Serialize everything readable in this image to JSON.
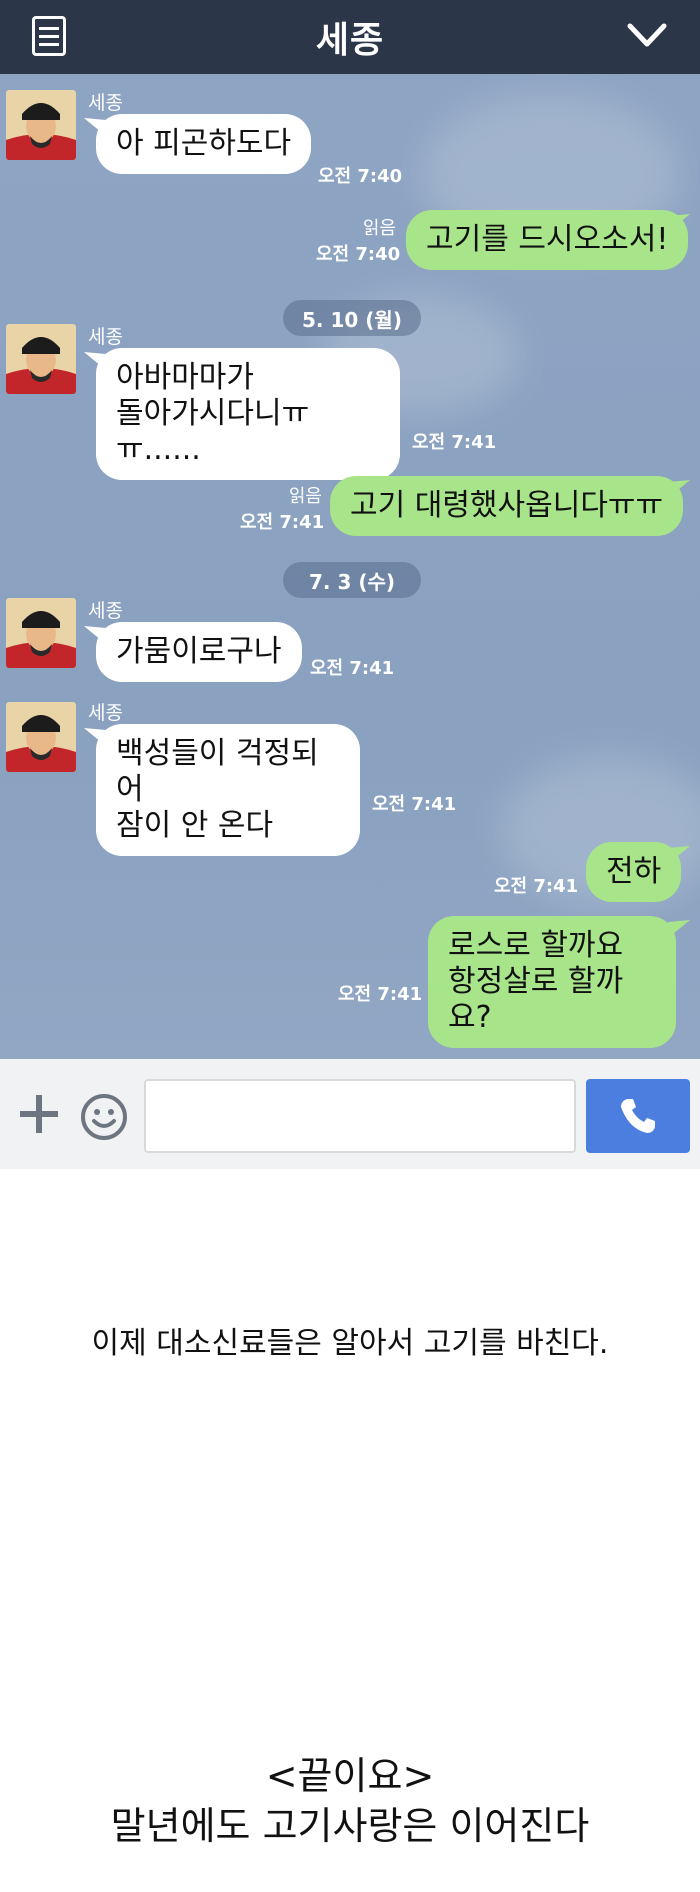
{
  "header": {
    "title": "세종"
  },
  "chat": {
    "messages": [
      {
        "sender": "세종",
        "text": "아 피곤하도다",
        "time": "오전 7:40"
      },
      {
        "read": "읽음",
        "text": "고기를 드시오소서!",
        "time": "오전 7:40"
      },
      {
        "text1": "아바마마가",
        "text2": "돌아가시다니ㅠㅠ......",
        "sender": "세종",
        "time": "오전 7:41"
      },
      {
        "read": "읽음",
        "text": "고기 대령했사옵니다ㅠㅠ",
        "time": "오전 7:41"
      },
      {
        "sender": "세종",
        "text": "가뭄이로구나",
        "time": "오전 7:41"
      },
      {
        "sender": "세종",
        "text1": "백성들이 걱정되어",
        "text2": "잠이 안 온다",
        "time": "오전 7:41"
      },
      {
        "text": "전하",
        "time": "오전 7:41"
      },
      {
        "text1": "로스로 할까요",
        "text2": "항정살로 할까요?",
        "time": "오전 7:41"
      }
    ],
    "dates": [
      "5. 10 (월)",
      "7. 3 (수)"
    ]
  },
  "caption": "이제 대소신료들은 알아서 고기를 바친다.",
  "ending": {
    "line1": "<끝이요>",
    "line2": "말년에도 고기사랑은 이어진다"
  },
  "icons": {
    "menu": "menu-icon",
    "chevron": "chevron-down-icon",
    "plus": "plus-icon",
    "smile": "smile-icon",
    "phone": "phone-icon"
  },
  "colors": {
    "header": "#2b3648",
    "outgoing": "#a8e48a",
    "incoming": "#ffffff",
    "call": "#4c7ee0"
  }
}
